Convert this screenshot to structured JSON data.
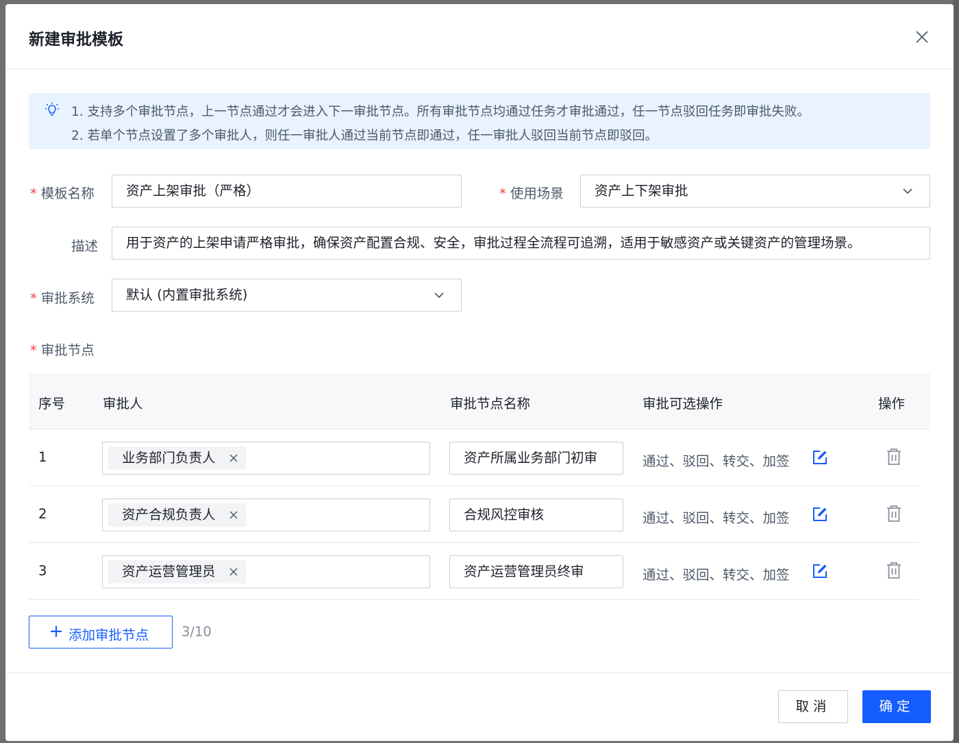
{
  "modal": {
    "title": "新建审批模板",
    "tips": [
      "1. 支持多个审批节点，上一节点通过才会进入下一审批节点。所有审批节点均通过任务才审批通过，任一节点驳回任务即审批失败。",
      "2. 若单个节点设置了多个审批人，则任一审批人通过当前节点即通过，任一审批人驳回当前节点即驳回。"
    ],
    "form": {
      "template_name_label": "模板名称",
      "template_name_value": "资产上架审批（严格）",
      "scene_label": "使用场景",
      "scene_value": "资产上下架审批",
      "desc_label": "描述",
      "desc_value": "用于资产的上架申请严格审批，确保资产配置合规、安全，审批过程全流程可追溯，适用于敏感资产或关键资产的管理场景。",
      "system_label": "审批系统",
      "system_value": "默认 (内置审批系统)",
      "nodes_label": "审批节点"
    },
    "table": {
      "headers": [
        "序号",
        "审批人",
        "审批节点名称",
        "审批可选操作",
        "操作"
      ],
      "rows": [
        {
          "num": "1",
          "approver": "业务部门负责人",
          "node_name": "资产所属业务部门初审",
          "ops": "通过、驳回、转交、加签"
        },
        {
          "num": "2",
          "approver": "资产合规负责人",
          "node_name": "合规风控审核",
          "ops": "通过、驳回、转交、加签"
        },
        {
          "num": "3",
          "approver": "资产运营管理员",
          "node_name": "资产运营管理员终审",
          "ops": "通过、驳回、转交、加签"
        }
      ]
    },
    "add_node_label": "添加审批节点",
    "node_count": "3/10",
    "cancel_label": "取消",
    "ok_label": "确定"
  },
  "colors": {
    "primary": "#165dff",
    "required": "#f53f3f",
    "tip_bg": "#e8f3ff"
  }
}
